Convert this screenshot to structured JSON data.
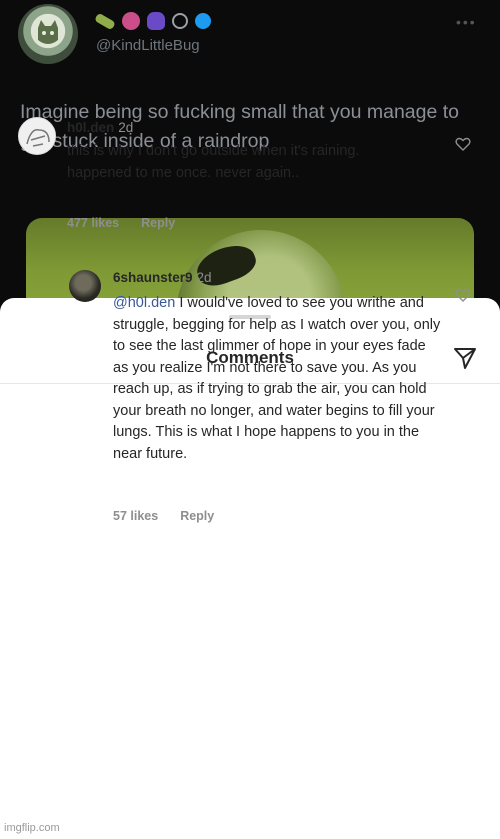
{
  "tweet": {
    "handle": "@KindLittleBug",
    "text": "Imagine being so fucking small that you manage to get stuck inside of a raindrop",
    "more_icon": "more-icon",
    "emoji_icons": [
      "bug-emoji",
      "lotus-emoji",
      "hamsa-emoji",
      "link-emoji",
      "verified-icon"
    ]
  },
  "sheet": {
    "title": "Comments",
    "share_icon": "send-icon"
  },
  "comments": [
    {
      "username": "h0l.den",
      "time": "2d",
      "text": "this is why I don't go outside when it's raining. happened to me once. never again..",
      "likes": "477 likes",
      "reply_label": "Reply"
    },
    {
      "username": "6shaunster9",
      "time": "2d",
      "mention": "@h0l.den",
      "text": " I would've loved to see you writhe and struggle, begging for help as I watch over you, only to see the last glimmer of hope in your eyes fade as you realize I'm not there to save you. As you reach up, as if trying to grab the air, you can hold your breath no longer, and water begins to fill your lungs. This is what I hope happens to you in the near future.",
      "likes": "57 likes",
      "reply_label": "Reply"
    }
  ],
  "watermark": "imgflip.com",
  "colors": {
    "mention": "#385898",
    "muted": "#8e8e8e",
    "tweet_text": "#8b9096",
    "verified": "#1d9bf0"
  }
}
